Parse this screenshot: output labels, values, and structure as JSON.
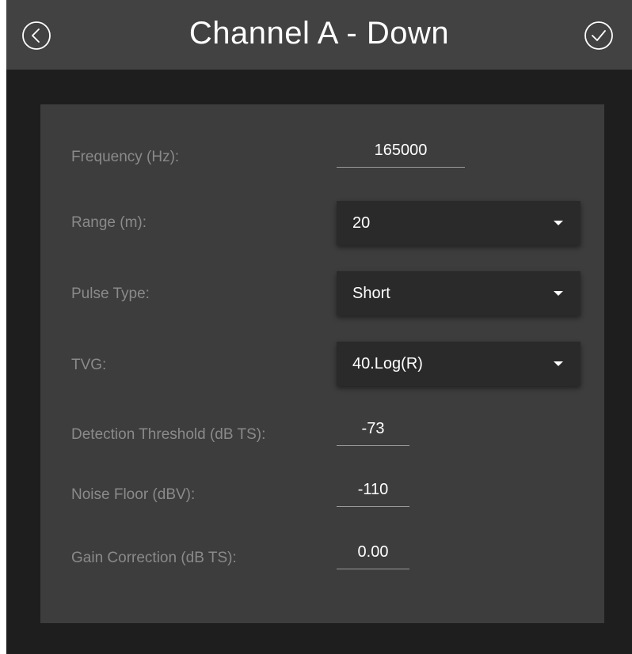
{
  "header": {
    "title": "Channel A - Down",
    "back_icon": "back-circle-icon",
    "confirm_icon": "check-circle-icon"
  },
  "form": {
    "frequency": {
      "label": "Frequency (Hz):",
      "value": "165000"
    },
    "range": {
      "label": "Range (m):",
      "value": "20"
    },
    "pulse_type": {
      "label": "Pulse Type:",
      "value": "Short"
    },
    "tvg": {
      "label": "TVG:",
      "value": "40.Log(R)"
    },
    "detection_threshold": {
      "label": "Detection Threshold (dB TS):",
      "value": "-73"
    },
    "noise_floor": {
      "label": "Noise Floor (dBV):",
      "value": "-110"
    },
    "gain_correction": {
      "label": "Gain Correction (dB TS):",
      "value": "0.00"
    }
  },
  "colors": {
    "background": "#1e1e1e",
    "header": "#424242",
    "panel": "#3d3d3d",
    "dropdown": "#2a2a2a",
    "label": "#8a8a8a",
    "text": "#ffffff"
  }
}
